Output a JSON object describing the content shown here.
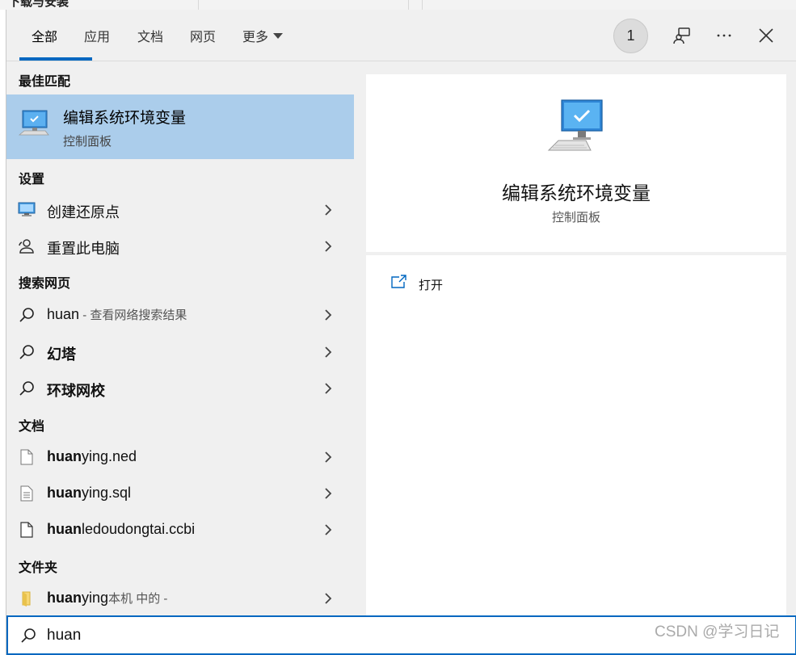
{
  "background": {
    "title": "下载与安装"
  },
  "header": {
    "tabs": [
      {
        "label": "全部",
        "active": true
      },
      {
        "label": "应用",
        "active": false
      },
      {
        "label": "文档",
        "active": false
      },
      {
        "label": "网页",
        "active": false
      },
      {
        "label": "更多",
        "active": false
      }
    ],
    "badge_count": "1",
    "icons": [
      "feedback-icon",
      "more-options-icon",
      "close-icon"
    ],
    "accent_color": "#0067c0"
  },
  "sections": {
    "best_match": "最佳匹配",
    "settings": "设置",
    "web": "搜索网页",
    "documents": "文档",
    "folders": "文件夹"
  },
  "best_match": {
    "title": "编辑系统环境变量",
    "subtitle": "控制面板",
    "icon": "computer-monitor-icon",
    "highlight_color": "#abcdeb"
  },
  "settings": [
    {
      "label": "创建还原点",
      "icon": "monitor-icon"
    },
    {
      "label": "重置此电脑",
      "icon": "reset-user-icon"
    }
  ],
  "web": [
    {
      "bold": "",
      "text": "huan",
      "sub": " - 查看网络搜索结果"
    },
    {
      "bold": "幻塔",
      "text": "",
      "sub": ""
    },
    {
      "bold": "环球网校",
      "text": "",
      "sub": ""
    }
  ],
  "documents": [
    {
      "bold": "huan",
      "text": "ying.ned"
    },
    {
      "bold": "huan",
      "text": "ying.sql"
    },
    {
      "bold": "huan",
      "text": "ledoudongtai.ccbi"
    }
  ],
  "folders": [
    {
      "bold": "huan",
      "text": "ying",
      "sub": "本机 中的 -"
    }
  ],
  "preview": {
    "title": "编辑系统环境变量",
    "subtitle": "控制面板",
    "actions": [
      {
        "label": "打开",
        "icon": "open-icon"
      }
    ]
  },
  "search": {
    "value": "huan",
    "placeholder": ""
  },
  "watermark": "CSDN @学习日记"
}
